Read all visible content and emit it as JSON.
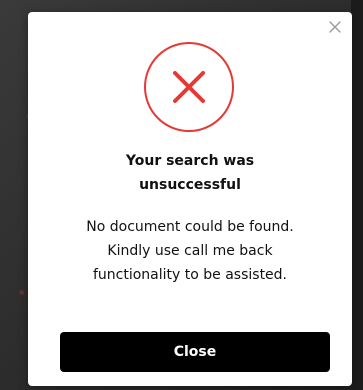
{
  "dialog": {
    "title_line1": "Your search was",
    "title_line2": "unsuccessful",
    "message_line1": "No document could be found.",
    "message_line2": "Kindly use call me back",
    "message_line3": "functionality to be assisted.",
    "close_button_label": "Close"
  },
  "icons": {
    "dismiss": "close-x-icon",
    "status": "error-x-icon"
  },
  "colors": {
    "error_red": "#e53935",
    "button_bg": "#000000",
    "button_text": "#ffffff",
    "text": "#111111"
  }
}
